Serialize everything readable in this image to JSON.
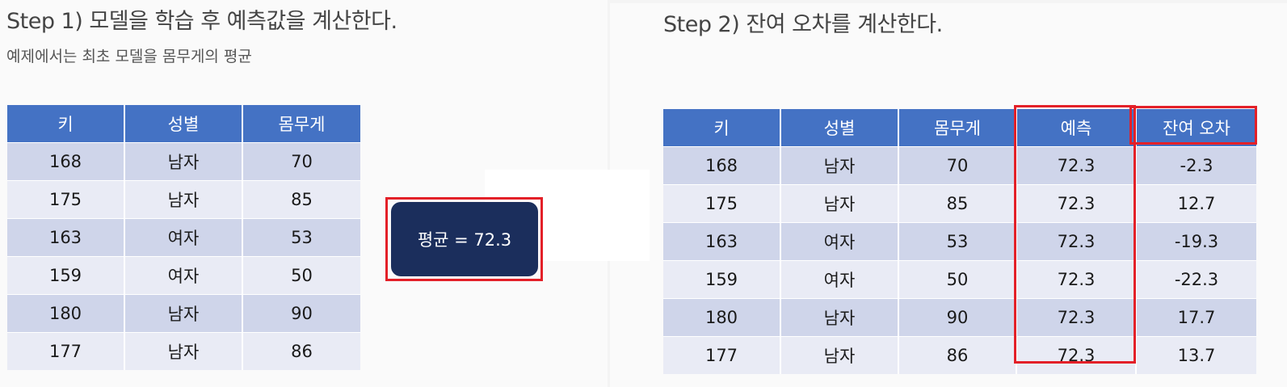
{
  "step1": {
    "title": "Step 1) 모델을 학습 후 예측값을 계산한다.",
    "subtitle": "예제에서는 최초 모델을 몸무게의 평균",
    "headers": [
      "키",
      "성별",
      "몸무게"
    ],
    "rows": [
      [
        "168",
        "남자",
        "70"
      ],
      [
        "175",
        "남자",
        "85"
      ],
      [
        "163",
        "여자",
        "53"
      ],
      [
        "159",
        "여자",
        "50"
      ],
      [
        "180",
        "남자",
        "90"
      ],
      [
        "177",
        "남자",
        "86"
      ]
    ]
  },
  "average_box": {
    "label": "평균 = 72.3"
  },
  "step2": {
    "title": "Step 2) 잔여 오차를 계산한다.",
    "headers": [
      "키",
      "성별",
      "몸무게",
      "예측",
      "잔여 오차"
    ],
    "rows": [
      [
        "168",
        "남자",
        "70",
        "72.3",
        "-2.3"
      ],
      [
        "175",
        "남자",
        "85",
        "72.3",
        "12.7"
      ],
      [
        "163",
        "여자",
        "53",
        "72.3",
        "-19.3"
      ],
      [
        "159",
        "여자",
        "50",
        "72.3",
        "-22.3"
      ],
      [
        "180",
        "남자",
        "90",
        "72.3",
        "17.7"
      ],
      [
        "177",
        "남자",
        "86",
        "72.3",
        "13.7"
      ]
    ]
  },
  "colors": {
    "header_blue": "#4472c4",
    "row_dark": "#cfd5ea",
    "row_light": "#e9ebf5",
    "highlight_red": "#e32028",
    "average_box": "#1b2e5c"
  }
}
